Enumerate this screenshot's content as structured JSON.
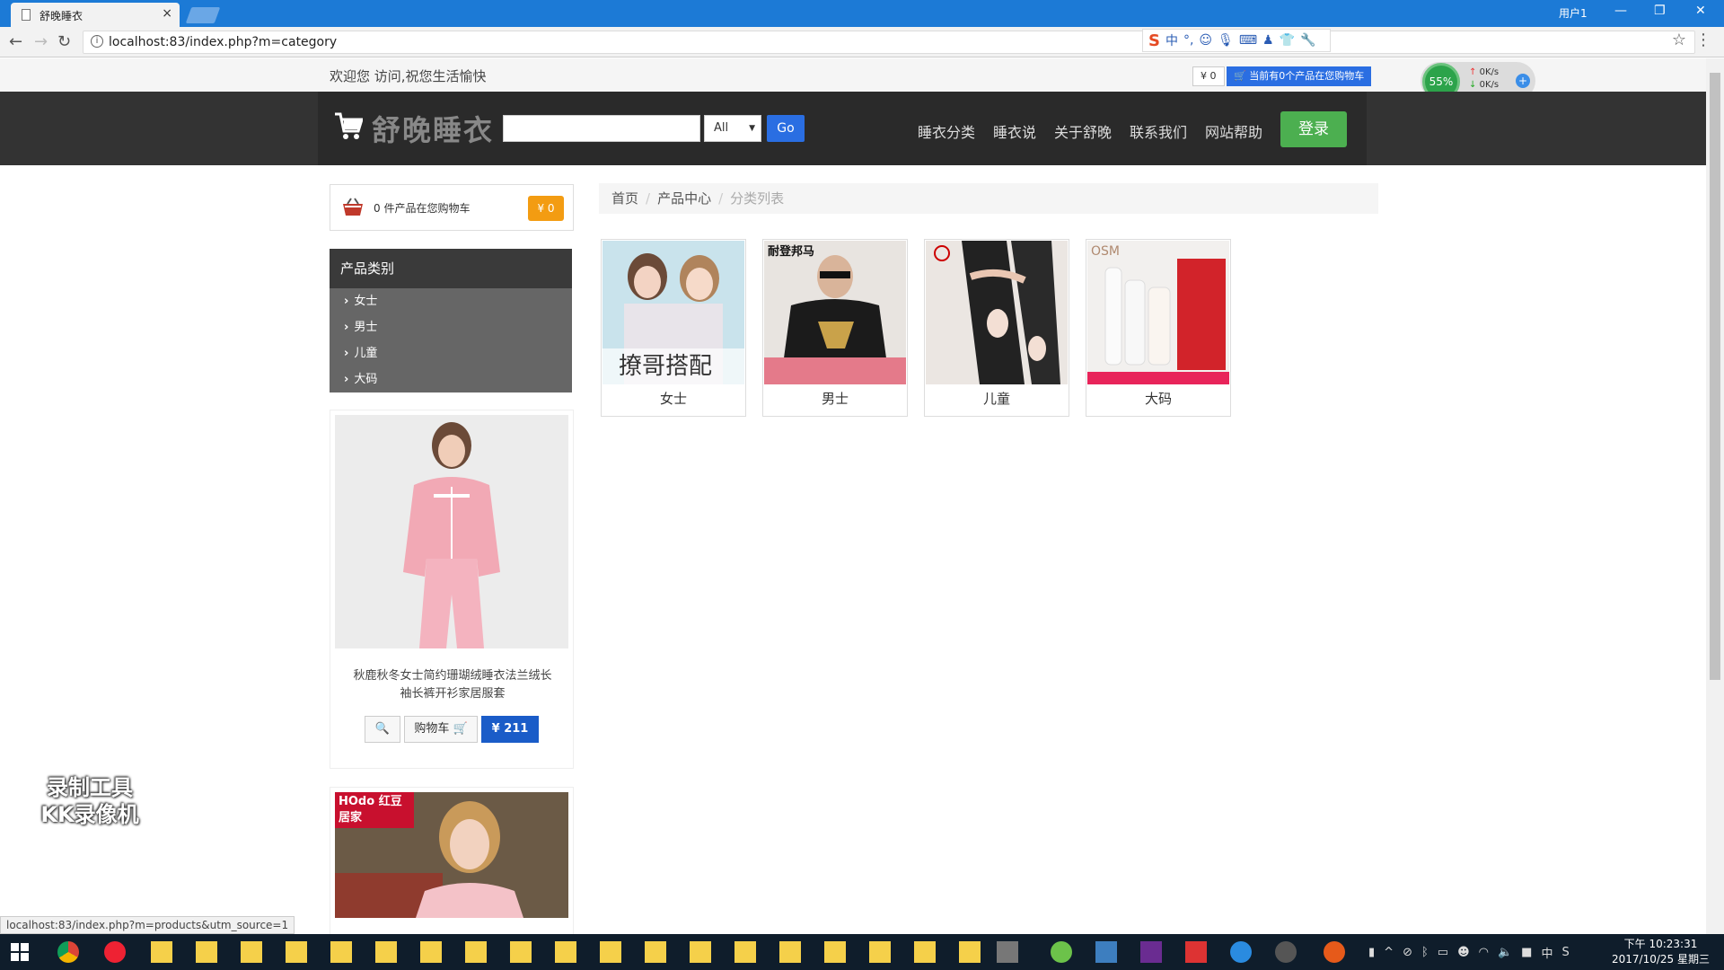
{
  "browser": {
    "tab_title": "舒晚睡衣",
    "url": "localhost:83/index.php?m=category",
    "user_label": "用户1",
    "status_url": "localhost:83/index.php?m=products&utm_source=1"
  },
  "topbar": {
    "welcome": "欢迎您 访问,祝您生活愉快",
    "mini_price": "¥ 0",
    "mini_cart": "当前有0个产品在您购物车",
    "speed_percent": "55%",
    "speed_up": "0K/s",
    "speed_down": "0K/s"
  },
  "header": {
    "logo_text": "舒晚睡衣",
    "search_placeholder": "",
    "search_select": "All",
    "go_label": "Go",
    "nav": [
      "睡衣分类",
      "睡衣说",
      "关于舒晚",
      "联系我们",
      "网站帮助"
    ],
    "login_label": "登录"
  },
  "sidebar": {
    "cart_text": "0 件产品在您购物车",
    "cart_badge": "¥ 0",
    "category_title": "产品类别",
    "categories": [
      "女士",
      "男士",
      "儿童",
      "大码"
    ],
    "featured": {
      "desc_line1": "秋鹿秋冬女士简约珊瑚绒睡衣法兰绒长",
      "desc_line2": "袖长裤开衫家居服套",
      "cart_label": "购物车",
      "price": "¥ 211"
    },
    "featured2_brand": "HOdo 红豆居家"
  },
  "main": {
    "breadcrumb": [
      "首页",
      "产品中心",
      "分类列表"
    ],
    "cards": [
      {
        "label": "女士",
        "caption": "撩哥搭配"
      },
      {
        "label": "男士",
        "caption": "耐登邦马"
      },
      {
        "label": "儿童",
        "caption": ""
      },
      {
        "label": "大码",
        "caption": "OSM"
      }
    ]
  },
  "watermark": {
    "line1": "录制工具",
    "line2": "KK录像机"
  },
  "taskbar": {
    "time": "下午 10:23:31",
    "date": "2017/10/25 星期三",
    "ime": "中"
  }
}
